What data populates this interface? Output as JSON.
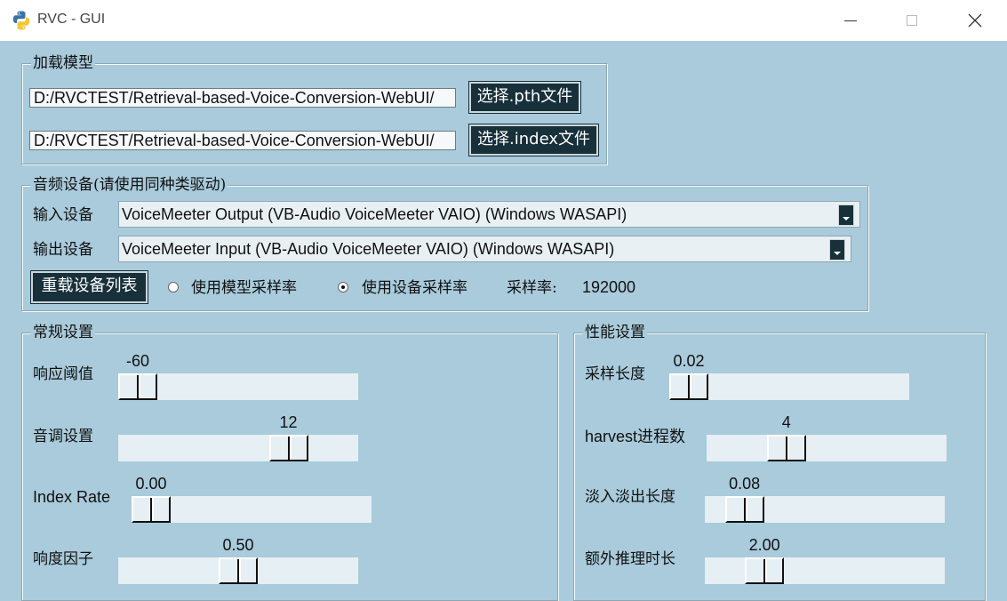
{
  "window": {
    "title": "RVC - GUI"
  },
  "load_model": {
    "legend": "加载模型",
    "pth_path": "D:/RVCTEST/Retrieval-based-Voice-Conversion-WebUI/",
    "pth_button": "选择.pth文件",
    "index_path": "D:/RVCTEST/Retrieval-based-Voice-Conversion-WebUI/",
    "index_button": "选择.index文件"
  },
  "audio_device": {
    "legend": "音频设备(请使用同种类驱动)",
    "input_label": "输入设备",
    "input_value": "VoiceMeeter Output (VB-Audio VoiceMeeter VAIO) (Windows WASAPI)",
    "output_label": "输出设备",
    "output_value": "VoiceMeeter Input (VB-Audio VoiceMeeter VAIO) (Windows WASAPI)",
    "reload_button": "重载设备列表",
    "radio_model_sr": "使用模型采样率",
    "radio_device_sr": "使用设备采样率",
    "selected_radio": "device",
    "sr_label": "采样率:",
    "sr_value": "192000"
  },
  "general": {
    "legend": "常规设置",
    "sliders": [
      {
        "label": "响应阈值",
        "value": "-60",
        "fraction": 0.0
      },
      {
        "label": "音调设置",
        "value": "12",
        "fraction": 0.75
      },
      {
        "label": "Index Rate",
        "value": "0.00",
        "fraction": 0.0
      },
      {
        "label": "响度因子",
        "value": "0.50",
        "fraction": 0.5
      }
    ]
  },
  "performance": {
    "legend": "性能设置",
    "sliders": [
      {
        "label": "采样长度",
        "value": "0.02",
        "fraction": 0.0
      },
      {
        "label": "harvest进程数",
        "value": "4",
        "fraction": 0.3
      },
      {
        "label": "淡入淡出长度",
        "value": "0.08",
        "fraction": 0.1
      },
      {
        "label": "额外推理时长",
        "value": "2.00",
        "fraction": 0.2
      }
    ]
  }
}
